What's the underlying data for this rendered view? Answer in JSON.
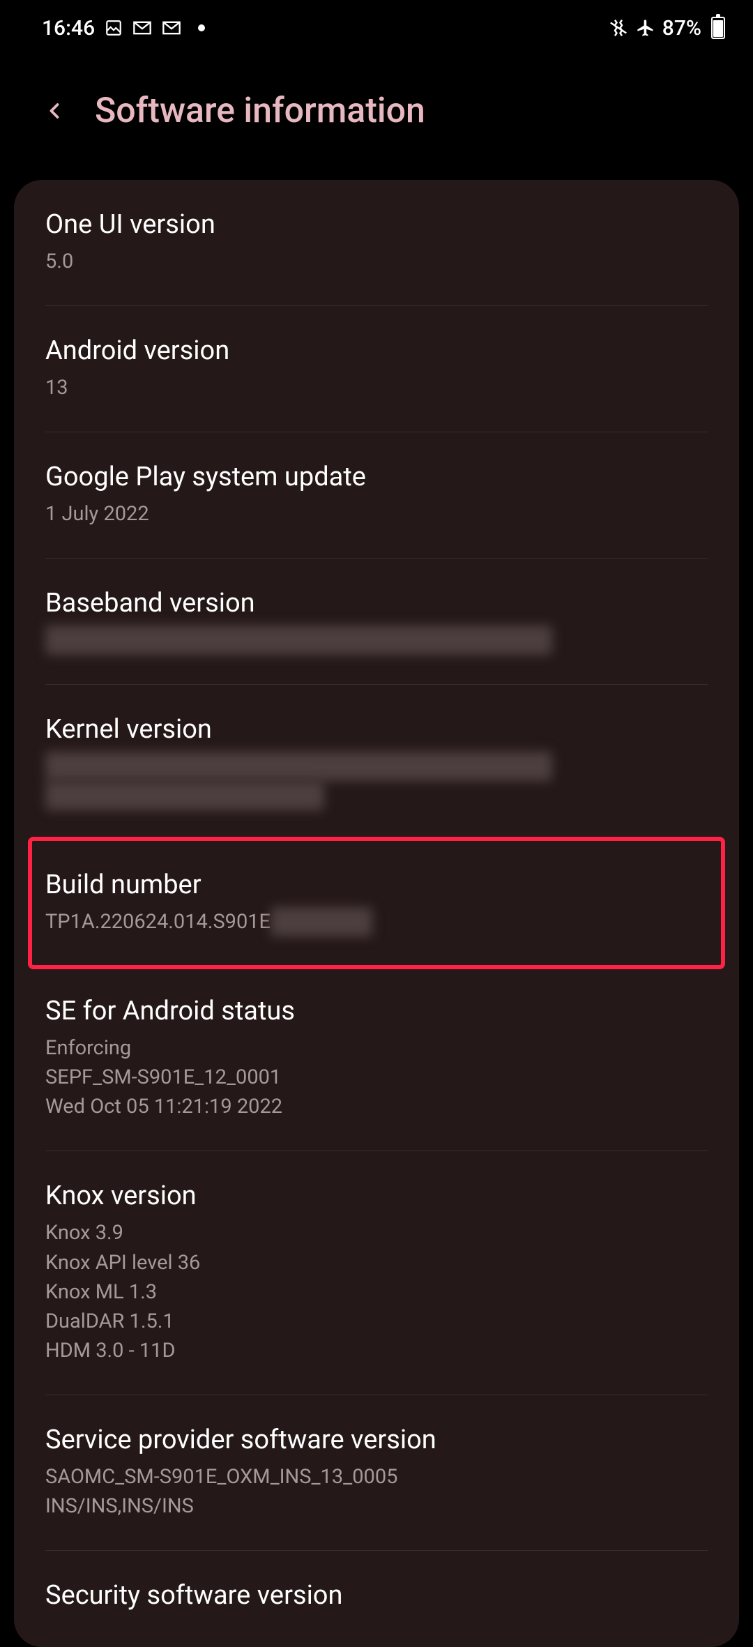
{
  "statusbar": {
    "time": "16:46",
    "battery_percent": "87%"
  },
  "header": {
    "title": "Software information"
  },
  "items": [
    {
      "title": "One UI version",
      "value": "5.0",
      "redacted": false,
      "highlighted": false
    },
    {
      "title": "Android version",
      "value": "13",
      "redacted": false,
      "highlighted": false
    },
    {
      "title": "Google Play system update",
      "value": "1 July 2022",
      "redacted": false,
      "highlighted": false
    },
    {
      "title": "Baseband version",
      "value": "",
      "redacted": true,
      "redacted_lines": 1,
      "highlighted": false
    },
    {
      "title": "Kernel version",
      "value": "",
      "redacted": true,
      "redacted_lines": 2,
      "highlighted": false
    },
    {
      "title": "Build number",
      "value": "TP1A.220624.014.S901E",
      "partial_redacted": true,
      "highlighted": true
    },
    {
      "title": "SE for Android status",
      "value": "Enforcing\nSEPF_SM-S901E_12_0001\nWed Oct 05 11:21:19 2022",
      "redacted": false,
      "highlighted": false
    },
    {
      "title": "Knox version",
      "value": "Knox 3.9\nKnox API level 36\nKnox ML 1.3\nDualDAR 1.5.1\nHDM 3.0 - 11D",
      "redacted": false,
      "highlighted": false
    },
    {
      "title": "Service provider software version",
      "value": "SAOMC_SM-S901E_OXM_INS_13_0005\nINS/INS,INS/INS",
      "redacted": false,
      "highlighted": false
    },
    {
      "title": "Security software version",
      "value": "",
      "redacted": false,
      "highlighted": false
    }
  ]
}
